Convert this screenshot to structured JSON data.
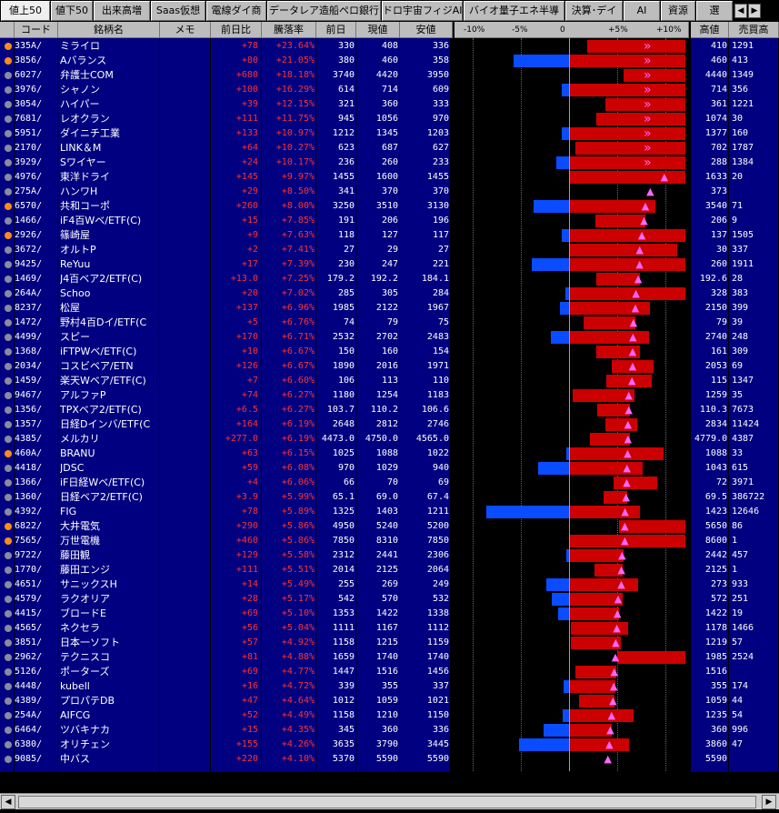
{
  "tabs": [
    {
      "label": "値上50",
      "active": true
    },
    {
      "label": "値下50"
    },
    {
      "label": "出来高増"
    },
    {
      "label": "Saas仮想"
    },
    {
      "label": "電線ダイ商"
    },
    {
      "label": "データレア造船ペロ銀行"
    },
    {
      "label": "ドロ宇宙フィジAI"
    },
    {
      "label": "バイオ量子エネ半導"
    },
    {
      "label": "決算･デイ"
    },
    {
      "label": "AI"
    },
    {
      "label": "資源"
    },
    {
      "label": "選"
    }
  ],
  "headers": {
    "code": "コード",
    "name": "銘柄名",
    "memo": "メモ",
    "change": "前日比",
    "rate": "騰落率",
    "prev": "前日",
    "current": "現値",
    "low": "安値",
    "high": "高値",
    "volume": "売買高"
  },
  "chart_axis": {
    "tick_labels": [
      "-10%",
      "-5%",
      "0",
      "+5%",
      "+10%"
    ],
    "tick_values": [
      -10,
      -5,
      0,
      5,
      10
    ],
    "range": [
      -10,
      12
    ]
  },
  "colors": {
    "row_bg": "#000080",
    "up_text": "#ff3333",
    "bar_up": "#cc0000",
    "bar_down": "#0a4cff",
    "marker": "#ff66ff",
    "dot_orange": "#ff8c1a",
    "dot_gray": "#8a8aa0"
  },
  "rows": [
    {
      "dot": "orange",
      "code": "335A/",
      "name": "ミライロ",
      "change": "+78",
      "rate": "+23.64%",
      "prev": "330",
      "cur": "408",
      "low": "336",
      "high": "410",
      "vol": "1291",
      "open_pct": 1.8,
      "marker_pct": 12,
      "marker": "double"
    },
    {
      "dot": "orange",
      "code": "3856/",
      "name": "Aバランス",
      "change": "+80",
      "rate": "+21.05%",
      "prev": "380",
      "cur": "460",
      "low": "358",
      "high": "460",
      "vol": "413",
      "open_pct": -5.8,
      "marker_pct": 12,
      "marker": "double"
    },
    {
      "dot": "gray",
      "code": "6027/",
      "name": "弁護士COM",
      "change": "+680",
      "rate": "+18.18%",
      "prev": "3740",
      "cur": "4420",
      "low": "3950",
      "high": "4440",
      "vol": "1349",
      "open_pct": 5.6,
      "marker_pct": 12,
      "marker": "double"
    },
    {
      "dot": "gray",
      "code": "3976/",
      "name": "シャノン",
      "change": "+100",
      "rate": "+16.29%",
      "prev": "614",
      "cur": "714",
      "low": "609",
      "high": "714",
      "vol": "356",
      "open_pct": -0.8,
      "marker_pct": 12,
      "marker": "double"
    },
    {
      "dot": "gray",
      "code": "3054/",
      "name": "ハイパー",
      "change": "+39",
      "rate": "+12.15%",
      "prev": "321",
      "cur": "360",
      "low": "333",
      "high": "361",
      "vol": "1221",
      "open_pct": 3.7,
      "marker_pct": 12,
      "marker": "double"
    },
    {
      "dot": "gray",
      "code": "7681/",
      "name": "レオクラン",
      "change": "+111",
      "rate": "+11.75%",
      "prev": "945",
      "cur": "1056",
      "low": "970",
      "high": "1074",
      "vol": "30",
      "open_pct": 2.7,
      "marker_pct": 12,
      "marker": "double"
    },
    {
      "dot": "gray",
      "code": "5951/",
      "name": "ダイニチ工業",
      "change": "+133",
      "rate": "+10.97%",
      "prev": "1212",
      "cur": "1345",
      "low": "1203",
      "high": "1377",
      "vol": "160",
      "open_pct": -0.8,
      "marker_pct": 12,
      "marker": "double"
    },
    {
      "dot": "gray",
      "code": "2170/",
      "name": "LINK＆M",
      "change": "+64",
      "rate": "+10.27%",
      "prev": "623",
      "cur": "687",
      "low": "627",
      "high": "702",
      "vol": "1787",
      "open_pct": 0.6,
      "marker_pct": 12,
      "marker": "double"
    },
    {
      "dot": "gray",
      "code": "3929/",
      "name": "Sワイヤー",
      "change": "+24",
      "rate": "+10.17%",
      "prev": "236",
      "cur": "260",
      "low": "233",
      "high": "288",
      "vol": "1384",
      "open_pct": -1.3,
      "marker_pct": 12,
      "marker": "double"
    },
    {
      "dot": "gray",
      "code": "4976/",
      "name": "東洋ドライ",
      "change": "+145",
      "rate": "+9.97%",
      "prev": "1455",
      "cur": "1600",
      "low": "1455",
      "high": "1633",
      "vol": "20",
      "open_pct": 0,
      "marker_pct": 9.97,
      "marker": "tri",
      "bar_end": 12
    },
    {
      "dot": "gray",
      "code": "275A/",
      "name": "ハンワH",
      "change": "+29",
      "rate": "+8.50%",
      "prev": "341",
      "cur": "370",
      "low": "370",
      "high": "373",
      "vol": "",
      "open_pct": 8.5,
      "marker_pct": 8.5,
      "marker": "tri"
    },
    {
      "dot": "orange",
      "code": "6570/",
      "name": "共和コーポ",
      "change": "+260",
      "rate": "+8.00%",
      "prev": "3250",
      "cur": "3510",
      "low": "3130",
      "high": "3540",
      "vol": "71",
      "open_pct": -3.7,
      "marker_pct": 8.0,
      "marker": "tri",
      "bar_end": 8.9
    },
    {
      "dot": "gray",
      "code": "1466/",
      "name": "iF4百Wベ/ETF(C)",
      "change": "+15",
      "rate": "+7.85%",
      "prev": "191",
      "cur": "206",
      "low": "196",
      "high": "206",
      "vol": "9",
      "open_pct": 2.6,
      "marker_pct": 7.85,
      "marker": "tri"
    },
    {
      "dot": "orange",
      "code": "2926/",
      "name": "篠崎屋",
      "change": "+9",
      "rate": "+7.63%",
      "prev": "118",
      "cur": "127",
      "low": "117",
      "high": "137",
      "vol": "1505",
      "open_pct": -0.8,
      "marker_pct": 7.63,
      "marker": "tri",
      "bar_end": 12
    },
    {
      "dot": "gray",
      "code": "3672/",
      "name": "オルトP",
      "change": "+2",
      "rate": "+7.41%",
      "prev": "27",
      "cur": "29",
      "low": "27",
      "high": "30",
      "vol": "337",
      "open_pct": 0,
      "marker_pct": 7.41,
      "marker": "tri",
      "bar_end": 11.1
    },
    {
      "dot": "gray",
      "code": "9425/",
      "name": "ReYuu",
      "change": "+17",
      "rate": "+7.39%",
      "prev": "230",
      "cur": "247",
      "low": "221",
      "high": "260",
      "vol": "1911",
      "open_pct": -3.9,
      "marker_pct": 7.39,
      "marker": "tri",
      "bar_end": 12
    },
    {
      "dot": "gray",
      "code": "1469/",
      "name": "J4百ベア2/ETF(C)",
      "change": "+13.0",
      "rate": "+7.25%",
      "prev": "179.2",
      "cur": "192.2",
      "low": "184.1",
      "high": "192.6",
      "vol": "28",
      "open_pct": 2.7,
      "marker_pct": 7.25,
      "marker": "tri"
    },
    {
      "dot": "gray",
      "code": "264A/",
      "name": "Schoo",
      "change": "+20",
      "rate": "+7.02%",
      "prev": "285",
      "cur": "305",
      "low": "284",
      "high": "328",
      "vol": "383",
      "open_pct": -0.4,
      "marker_pct": 7.02,
      "marker": "tri",
      "bar_end": 12
    },
    {
      "dot": "gray",
      "code": "8237/",
      "name": "松屋",
      "change": "+137",
      "rate": "+6.96%",
      "prev": "1985",
      "cur": "2122",
      "low": "1967",
      "high": "2150",
      "vol": "399",
      "open_pct": -0.9,
      "marker_pct": 6.96,
      "marker": "tri",
      "bar_end": 8.3
    },
    {
      "dot": "gray",
      "code": "1472/",
      "name": "野村4百Dイ/ETF(C",
      "change": "+5",
      "rate": "+6.76%",
      "prev": "74",
      "cur": "79",
      "low": "75",
      "high": "79",
      "vol": "39",
      "open_pct": 1.4,
      "marker_pct": 6.76,
      "marker": "tri"
    },
    {
      "dot": "gray",
      "code": "4499/",
      "name": "スピー",
      "change": "+170",
      "rate": "+6.71%",
      "prev": "2532",
      "cur": "2702",
      "low": "2483",
      "high": "2740",
      "vol": "248",
      "open_pct": -1.9,
      "marker_pct": 6.71,
      "marker": "tri",
      "bar_end": 8.2
    },
    {
      "dot": "gray",
      "code": "1368/",
      "name": "iFTPWベ/ETF(C)",
      "change": "+10",
      "rate": "+6.67%",
      "prev": "150",
      "cur": "160",
      "low": "154",
      "high": "161",
      "vol": "309",
      "open_pct": 2.7,
      "marker_pct": 6.67,
      "marker": "tri",
      "bar_end": 7.3
    },
    {
      "dot": "gray",
      "code": "2034/",
      "name": "コスビベア/ETN",
      "change": "+126",
      "rate": "+6.67%",
      "prev": "1890",
      "cur": "2016",
      "low": "1971",
      "high": "2053",
      "vol": "69",
      "open_pct": 4.3,
      "marker_pct": 6.67,
      "marker": "tri",
      "bar_end": 8.7
    },
    {
      "dot": "gray",
      "code": "1459/",
      "name": "楽天Wベア/ETF(C)",
      "change": "+7",
      "rate": "+6.60%",
      "prev": "106",
      "cur": "113",
      "low": "110",
      "high": "115",
      "vol": "1347",
      "open_pct": 3.8,
      "marker_pct": 6.6,
      "marker": "tri",
      "bar_end": 8.5
    },
    {
      "dot": "gray",
      "code": "9467/",
      "name": "アルファP",
      "change": "+74",
      "rate": "+6.27%",
      "prev": "1180",
      "cur": "1254",
      "low": "1183",
      "high": "1259",
      "vol": "35",
      "open_pct": 0.3,
      "marker_pct": 6.27,
      "marker": "tri",
      "bar_end": 6.7
    },
    {
      "dot": "gray",
      "code": "1356/",
      "name": "TPXベア2/ETF(C)",
      "change": "+6.5",
      "rate": "+6.27%",
      "prev": "103.7",
      "cur": "110.2",
      "low": "106.6",
      "high": "110.3",
      "vol": "7673",
      "open_pct": 2.8,
      "marker_pct": 6.27,
      "marker": "tri"
    },
    {
      "dot": "gray",
      "code": "1357/",
      "name": "日経Dインバ/ETF(C",
      "change": "+164",
      "rate": "+6.19%",
      "prev": "2648",
      "cur": "2812",
      "low": "2746",
      "high": "2834",
      "vol": "11424",
      "open_pct": 3.7,
      "marker_pct": 6.19,
      "marker": "tri",
      "bar_end": 7.0
    },
    {
      "dot": "gray",
      "code": "4385/",
      "name": "メルカリ",
      "change": "+277.0",
      "rate": "+6.19%",
      "prev": "4473.0",
      "cur": "4750.0",
      "low": "4565.0",
      "high": "4779.0",
      "vol": "4387",
      "open_pct": 2.1,
      "marker_pct": 6.19,
      "marker": "tri"
    },
    {
      "dot": "orange",
      "code": "460A/",
      "name": "BRANU",
      "change": "+63",
      "rate": "+6.15%",
      "prev": "1025",
      "cur": "1088",
      "low": "1022",
      "high": "1088",
      "vol": "33",
      "open_pct": -0.3,
      "marker_pct": 6.15,
      "marker": "tri",
      "bar_end": 9.7
    },
    {
      "dot": "gray",
      "code": "4418/",
      "name": "JDSC",
      "change": "+59",
      "rate": "+6.08%",
      "prev": "970",
      "cur": "1029",
      "low": "940",
      "high": "1043",
      "vol": "615",
      "open_pct": -3.2,
      "marker_pct": 6.08,
      "marker": "tri",
      "bar_end": 7.5
    },
    {
      "dot": "gray",
      "code": "1366/",
      "name": "iF日経Wベ/ETF(C)",
      "change": "+4",
      "rate": "+6.06%",
      "prev": "66",
      "cur": "70",
      "low": "69",
      "high": "72",
      "vol": "3971",
      "open_pct": 4.5,
      "marker_pct": 6.06,
      "marker": "tri",
      "bar_end": 9.1
    },
    {
      "dot": "gray",
      "code": "1360/",
      "name": "日経ベア2/ETF(C)",
      "change": "+3.9",
      "rate": "+5.99%",
      "prev": "65.1",
      "cur": "69.0",
      "low": "67.4",
      "high": "69.5",
      "vol": "386722",
      "open_pct": 3.5,
      "marker_pct": 5.99,
      "marker": "tri"
    },
    {
      "dot": "gray",
      "code": "4392/",
      "name": "FIG",
      "change": "+78",
      "rate": "+5.89%",
      "prev": "1325",
      "cur": "1403",
      "low": "1211",
      "high": "1423",
      "vol": "12646",
      "open_pct": -8.6,
      "marker_pct": 5.89,
      "marker": "tri",
      "bar_end": 7.3
    },
    {
      "dot": "orange",
      "code": "6822/",
      "name": "大井電気",
      "change": "+290",
      "rate": "+5.86%",
      "prev": "4950",
      "cur": "5240",
      "low": "5200",
      "high": "5650",
      "vol": "86",
      "open_pct": 5.1,
      "marker_pct": 5.86,
      "marker": "tri",
      "bar_end": 12
    },
    {
      "dot": "orange",
      "code": "7565/",
      "name": "万世電機",
      "change": "+460",
      "rate": "+5.86%",
      "prev": "7850",
      "cur": "8310",
      "low": "7850",
      "high": "8600",
      "vol": "1",
      "open_pct": 0,
      "marker_pct": 5.86,
      "marker": "tri",
      "bar_end": 12
    },
    {
      "dot": "gray",
      "code": "9722/",
      "name": "藤田観",
      "change": "+129",
      "rate": "+5.58%",
      "prev": "2312",
      "cur": "2441",
      "low": "2306",
      "high": "2442",
      "vol": "457",
      "open_pct": -0.3,
      "marker_pct": 5.58,
      "marker": "tri"
    },
    {
      "dot": "gray",
      "code": "1770/",
      "name": "藤田エンジ",
      "change": "+111",
      "rate": "+5.51%",
      "prev": "2014",
      "cur": "2125",
      "low": "2064",
      "high": "2125",
      "vol": "1",
      "open_pct": 2.5,
      "marker_pct": 5.51,
      "marker": "tri"
    },
    {
      "dot": "gray",
      "code": "4651/",
      "name": "サニックスH",
      "change": "+14",
      "rate": "+5.49%",
      "prev": "255",
      "cur": "269",
      "low": "249",
      "high": "273",
      "vol": "933",
      "open_pct": -2.4,
      "marker_pct": 5.49,
      "marker": "tri",
      "bar_end": 7.1
    },
    {
      "dot": "gray",
      "code": "4579/",
      "name": "ラクオリア",
      "change": "+28",
      "rate": "+5.17%",
      "prev": "542",
      "cur": "570",
      "low": "532",
      "high": "572",
      "vol": "251",
      "open_pct": -1.8,
      "marker_pct": 5.17,
      "marker": "tri",
      "bar_end": 5.5
    },
    {
      "dot": "gray",
      "code": "4415/",
      "name": "ブロードE",
      "change": "+69",
      "rate": "+5.10%",
      "prev": "1353",
      "cur": "1422",
      "low": "1338",
      "high": "1422",
      "vol": "19",
      "open_pct": -1.1,
      "marker_pct": 5.1,
      "marker": "tri"
    },
    {
      "dot": "gray",
      "code": "4565/",
      "name": "ネクセラ",
      "change": "+56",
      "rate": "+5.04%",
      "prev": "1111",
      "cur": "1167",
      "low": "1112",
      "high": "1178",
      "vol": "1466",
      "open_pct": 0.1,
      "marker_pct": 5.04,
      "marker": "tri",
      "bar_end": 6.0
    },
    {
      "dot": "gray",
      "code": "3851/",
      "name": "日本一ソフト",
      "change": "+57",
      "rate": "+4.92%",
      "prev": "1158",
      "cur": "1215",
      "low": "1159",
      "high": "1219",
      "vol": "57",
      "open_pct": 0.1,
      "marker_pct": 4.92,
      "marker": "tri",
      "bar_end": 5.3
    },
    {
      "dot": "gray",
      "code": "2962/",
      "name": "テクニスコ",
      "change": "+81",
      "rate": "+4.88%",
      "prev": "1659",
      "cur": "1740",
      "low": "1740",
      "high": "1985",
      "vol": "2524",
      "open_pct": 4.88,
      "marker_pct": 4.88,
      "marker": "tri",
      "bar_end": 12
    },
    {
      "dot": "gray",
      "code": "5126/",
      "name": "ポーターズ",
      "change": "+69",
      "rate": "+4.77%",
      "prev": "1447",
      "cur": "1516",
      "low": "1456",
      "high": "1516",
      "vol": "",
      "open_pct": 0.6,
      "marker_pct": 4.77,
      "marker": "tri"
    },
    {
      "dot": "gray",
      "code": "4448/",
      "name": "kubell",
      "change": "+16",
      "rate": "+4.72%",
      "prev": "339",
      "cur": "355",
      "low": "337",
      "high": "355",
      "vol": "174",
      "open_pct": -0.6,
      "marker_pct": 4.72,
      "marker": "tri"
    },
    {
      "dot": "gray",
      "code": "4389/",
      "name": "プロパテDB",
      "change": "+47",
      "rate": "+4.64%",
      "prev": "1012",
      "cur": "1059",
      "low": "1021",
      "high": "1059",
      "vol": "44",
      "open_pct": 0.9,
      "marker_pct": 4.64,
      "marker": "tri"
    },
    {
      "dot": "gray",
      "code": "254A/",
      "name": "AIFCG",
      "change": "+52",
      "rate": "+4.49%",
      "prev": "1158",
      "cur": "1210",
      "low": "1150",
      "high": "1235",
      "vol": "54",
      "open_pct": -0.7,
      "marker_pct": 4.49,
      "marker": "tri",
      "bar_end": 6.6
    },
    {
      "dot": "gray",
      "code": "6464/",
      "name": "ツバキナカ",
      "change": "+15",
      "rate": "+4.35%",
      "prev": "345",
      "cur": "360",
      "low": "336",
      "high": "360",
      "vol": "996",
      "open_pct": -2.6,
      "marker_pct": 4.35,
      "marker": "tri"
    },
    {
      "dot": "gray",
      "code": "6380/",
      "name": "オリチェン",
      "change": "+155",
      "rate": "+4.26%",
      "prev": "3635",
      "cur": "3790",
      "low": "3445",
      "high": "3860",
      "vol": "47",
      "open_pct": -5.2,
      "marker_pct": 4.26,
      "marker": "tri",
      "bar_end": 6.1
    },
    {
      "dot": "gray",
      "code": "9085/",
      "name": "中バス",
      "change": "+220",
      "rate": "+4.10%",
      "prev": "5370",
      "cur": "5590",
      "low": "5590",
      "high": "5590",
      "vol": "",
      "open_pct": 4.1,
      "marker_pct": 4.1,
      "marker": "tri"
    }
  ]
}
